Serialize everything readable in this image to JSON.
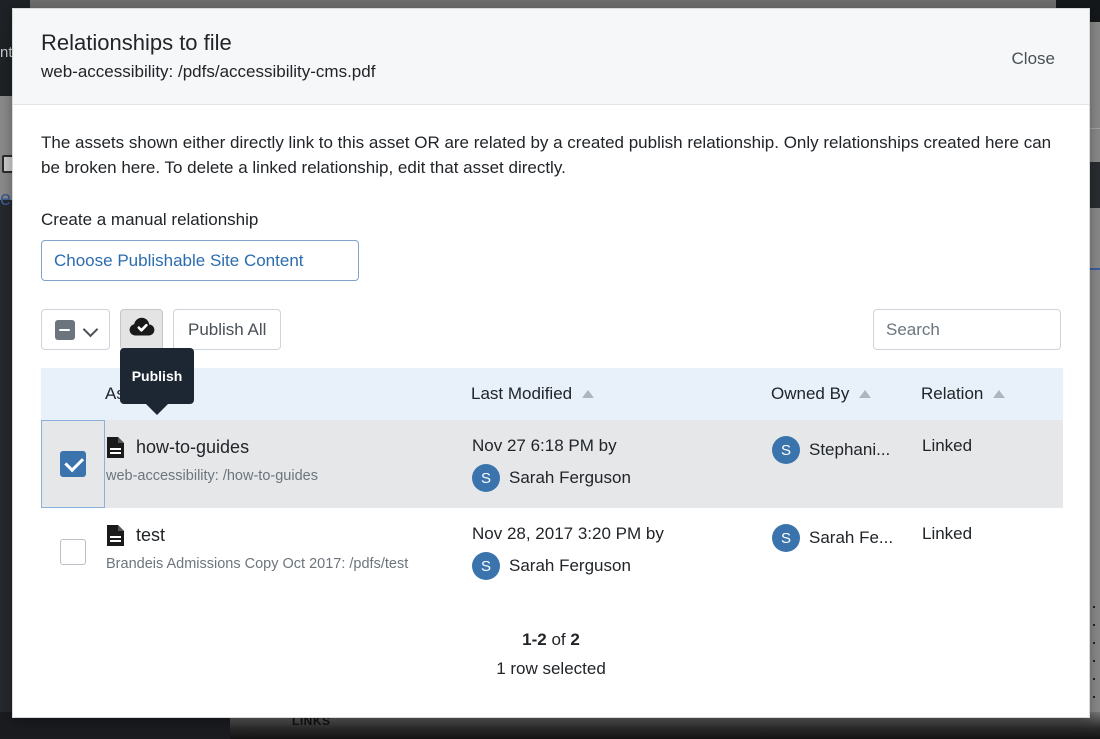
{
  "background": {
    "topbar_text": "nte",
    "left_text": "eb",
    "bottom_text": "LINKS"
  },
  "modal": {
    "title": "Relationships to file",
    "subtitle": "web-accessibility: /pdfs/accessibility-cms.pdf",
    "close_label": "Close",
    "description": "The assets shown either directly link to this asset OR are related by a created publish relationship. Only relationships created here can be broken here. To delete a linked relationship, edit that asset directly.",
    "manual_relationship_label": "Create a manual relationship",
    "choose_select_value": "Choose Publishable Site Content",
    "tooltip_text": "Publish"
  },
  "toolbar": {
    "select_all_state": "indeterminate",
    "publish_button_icon": "cloud-check-icon",
    "publish_all_label": "Publish All",
    "search_placeholder": "Search"
  },
  "table": {
    "columns": [
      {
        "label": "Asset",
        "sort": "asc",
        "active": true
      },
      {
        "label": "Last Modified",
        "sort": "asc",
        "active": false
      },
      {
        "label": "Owned By",
        "sort": "asc",
        "active": false
      },
      {
        "label": "Relation",
        "sort": "asc",
        "active": false
      }
    ],
    "rows": [
      {
        "selected": true,
        "asset_name": "how-to-guides",
        "asset_path": "web-accessibility: /how-to-guides",
        "modified_date": "Nov 27 6:18 PM by",
        "modified_by": "Sarah Ferguson",
        "modified_by_initial": "S",
        "owner": "Stephani...",
        "owner_initial": "S",
        "relation": "Linked"
      },
      {
        "selected": false,
        "asset_name": "test",
        "asset_path": "Brandeis Admissions Copy Oct 2017: /pdfs/test",
        "modified_date": "Nov 28, 2017 3:20 PM by",
        "modified_by": "Sarah Ferguson",
        "modified_by_initial": "S",
        "owner": "Sarah Fe...",
        "owner_initial": "S",
        "relation": "Linked"
      }
    ]
  },
  "footer": {
    "range_start": "1-2",
    "range_of": " of ",
    "range_total": "2",
    "selection_text": "1 row selected"
  },
  "colors": {
    "accent_blue": "#3b73ad",
    "header_row": "#e8f0fa",
    "selected_row": "#e5e7e9",
    "link_blue": "#2b6cb0",
    "tooltip_bg": "#1c2733"
  }
}
